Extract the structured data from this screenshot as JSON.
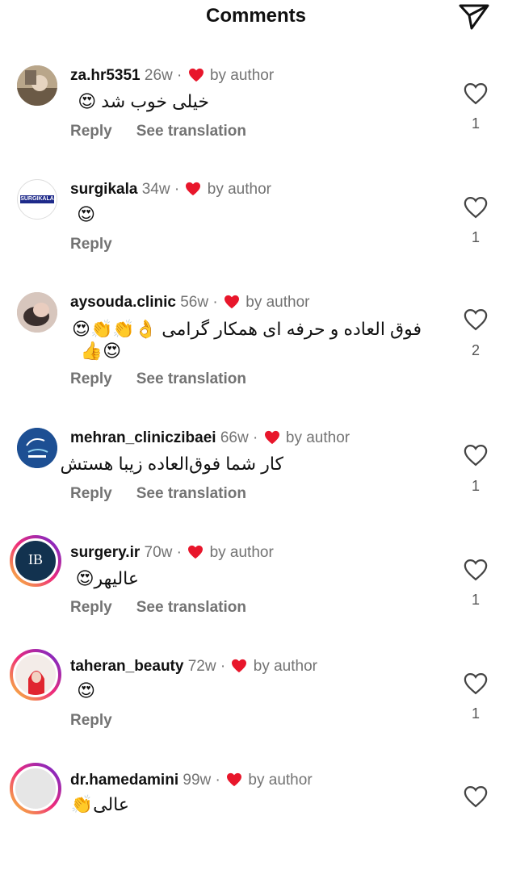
{
  "header": {
    "title": "Comments",
    "send_icon": "send-icon"
  },
  "heart_color": "#e8162b",
  "comments": [
    {
      "username": "za.hr5351",
      "time": "26w",
      "dot": "·",
      "by": "by author",
      "line1": "خیلی خوب شد 😍",
      "line2": "",
      "reply": "Reply",
      "translation": "See translation",
      "likes": "1"
    },
    {
      "username": "surgikala",
      "time": "34w",
      "dot": "·",
      "by": "by author",
      "line1": "😍",
      "line2": "",
      "reply": "Reply",
      "translation": "",
      "likes": "1",
      "avatar_text": "SURGIKALA"
    },
    {
      "username": "aysouda.clinic",
      "time": "56w",
      "dot": "·",
      "by": "by author",
      "line1": "فوق العاده و حرفه ای همکار گرامی 👌👏👏😍",
      "line2": "😍👍",
      "reply": "Reply",
      "translation": "See translation",
      "likes": "2"
    },
    {
      "username": "mehran_cliniczibaei",
      "time": "66w",
      "dot": "·",
      "by": "by author",
      "line1": "کار شما فوق‌العاده زیبا هستش",
      "line2": "",
      "reply": "Reply",
      "translation": "See translation",
      "likes": "1"
    },
    {
      "username": "surgery.ir",
      "time": "70w",
      "dot": "·",
      "by": "by author",
      "line1": "عالیهر😍",
      "line2": "",
      "reply": "Reply",
      "translation": "See translation",
      "likes": "1",
      "avatar_text": "IB"
    },
    {
      "username": "taheran_beauty",
      "time": "72w",
      "dot": "·",
      "by": "by author",
      "line1": "😍",
      "line2": "",
      "reply": "Reply",
      "translation": "",
      "likes": "1"
    },
    {
      "username": "dr.hamedamini",
      "time": "99w",
      "dot": "·",
      "by": "by author",
      "line1": "عالی👏",
      "line2": "",
      "reply": "",
      "translation": "",
      "likes": ""
    }
  ]
}
